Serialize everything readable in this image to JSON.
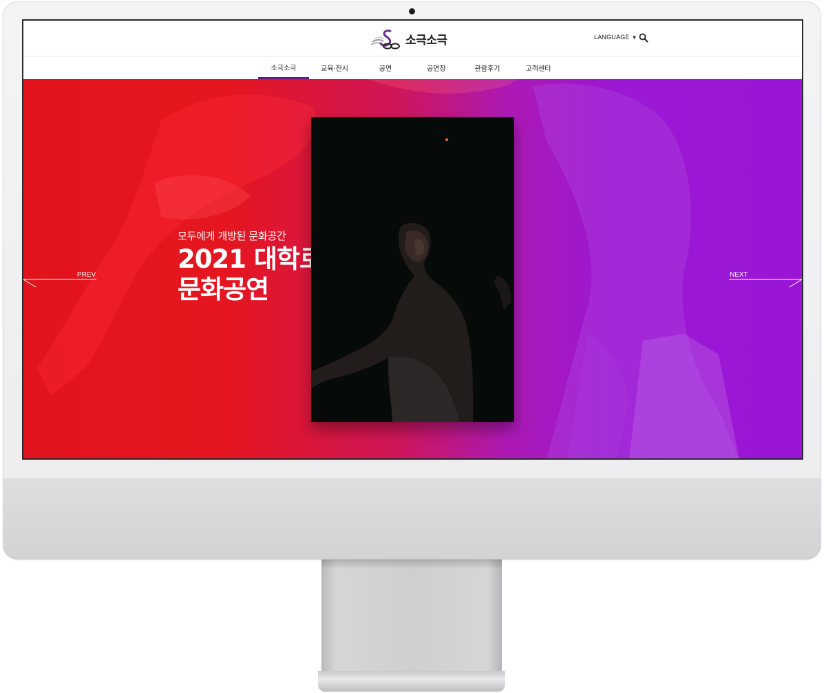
{
  "site": {
    "logo_text": "소극소극",
    "language_label": "LANGUAGE",
    "language_arrow": "▼"
  },
  "nav": {
    "items": [
      {
        "label": "소극소극",
        "active": true
      },
      {
        "label": "교육·전시",
        "active": false
      },
      {
        "label": "공연",
        "active": false
      },
      {
        "label": "공연장",
        "active": false
      },
      {
        "label": "관람후기",
        "active": false
      },
      {
        "label": "고객센터",
        "active": false
      }
    ]
  },
  "hero": {
    "subtitle": "모두에게 개방된 문화공간",
    "title_line1": "2021 대학로",
    "title_line2": "문화공연",
    "prev_label": "PREV",
    "next_label": "NEXT"
  },
  "colors": {
    "brand_purple": "#5b1e86",
    "hero_red": "#e2141d",
    "hero_violet": "#9a16d6"
  },
  "icons": [
    "logo-mark-icon",
    "search-icon",
    "prev-arrow-icon",
    "next-arrow-icon"
  ]
}
